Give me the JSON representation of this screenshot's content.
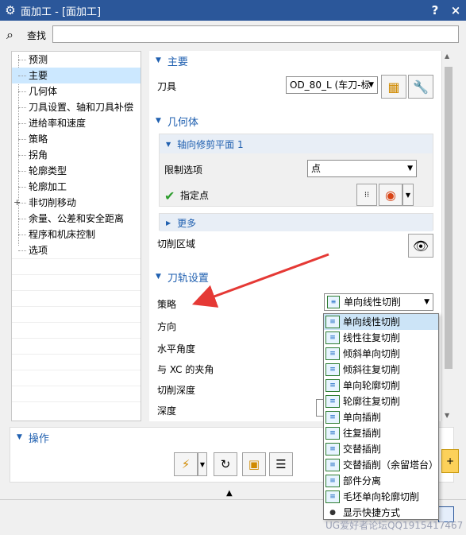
{
  "window": {
    "title": "面加工 - [面加工]",
    "help_label": "?",
    "close_label": "×"
  },
  "search": {
    "label": "查找",
    "value": ""
  },
  "tree": {
    "items": [
      {
        "label": "预测",
        "selected": false,
        "expander": ""
      },
      {
        "label": "主要",
        "selected": true,
        "expander": ""
      },
      {
        "label": "几何体",
        "selected": false,
        "expander": ""
      },
      {
        "label": "刀具设置、轴和刀具补偿",
        "selected": false,
        "expander": ""
      },
      {
        "label": "进给率和速度",
        "selected": false,
        "expander": ""
      },
      {
        "label": "策略",
        "selected": false,
        "expander": ""
      },
      {
        "label": "拐角",
        "selected": false,
        "expander": ""
      },
      {
        "label": "轮廓类型",
        "selected": false,
        "expander": ""
      },
      {
        "label": "轮廓加工",
        "selected": false,
        "expander": ""
      },
      {
        "label": "非切削移动",
        "selected": false,
        "expander": "+"
      },
      {
        "label": "余量、公差和安全距离",
        "selected": false,
        "expander": ""
      },
      {
        "label": "程序和机床控制",
        "selected": false,
        "expander": ""
      },
      {
        "label": "选项",
        "selected": false,
        "expander": ""
      }
    ]
  },
  "main_group": {
    "title": "主要",
    "tool_label": "刀具",
    "tool_value": "OD_80_L (车刀-标"
  },
  "geometry_group": {
    "title": "几何体",
    "sub_title": "轴向修剪平面 1",
    "limit_label": "限制选项",
    "limit_value": "点",
    "point_label": "指定点",
    "more_label": "更多",
    "cut_region_label": "切削区域"
  },
  "path_group": {
    "title": "刀轨设置",
    "strategy_label": "策略",
    "strategy_value": "单向线性切削",
    "direction_label": "方向",
    "horizontal_angle_label": "水平角度",
    "xc_angle_label": "与 XC 的夹角",
    "cut_depth_label": "切削深度",
    "depth_label": "深度"
  },
  "operations": {
    "title": "操作"
  },
  "strategy_options": [
    {
      "label": "单向线性切削",
      "highlighted": true,
      "icon": "linear-cut-icon"
    },
    {
      "label": "线性往复切削",
      "highlighted": false,
      "icon": "zigzag-cut-icon"
    },
    {
      "label": "倾斜单向切削",
      "highlighted": false,
      "icon": "ramp-cut-icon"
    },
    {
      "label": "倾斜往复切削",
      "highlighted": false,
      "icon": "ramp-zigzag-icon"
    },
    {
      "label": "单向轮廓切削",
      "highlighted": false,
      "icon": "contour-cut-icon"
    },
    {
      "label": "轮廓往复切削",
      "highlighted": false,
      "icon": "contour-zigzag-icon"
    },
    {
      "label": "单向插削",
      "highlighted": false,
      "icon": "plunge-icon"
    },
    {
      "label": "往复插削",
      "highlighted": false,
      "icon": "zigzag-plunge-icon"
    },
    {
      "label": "交替插削",
      "highlighted": false,
      "icon": "alternate-plunge-icon"
    },
    {
      "label": "交替插削（余留塔台）",
      "highlighted": false,
      "icon": "alternate-plunge-tower-icon"
    },
    {
      "label": "部件分离",
      "highlighted": false,
      "icon": "part-separation-icon"
    },
    {
      "label": "毛坯单向轮廓切削",
      "highlighted": false,
      "icon": "blank-contour-icon"
    },
    {
      "label": "显示快捷方式",
      "highlighted": false,
      "icon": "eye-icon"
    }
  ],
  "watermark": "UG爱好者论坛QQ1915417467",
  "colors": {
    "title_bar": "#2b579a",
    "group_header": "#2060b0",
    "highlight": "#cce4f7",
    "arrow": "#e53935"
  }
}
